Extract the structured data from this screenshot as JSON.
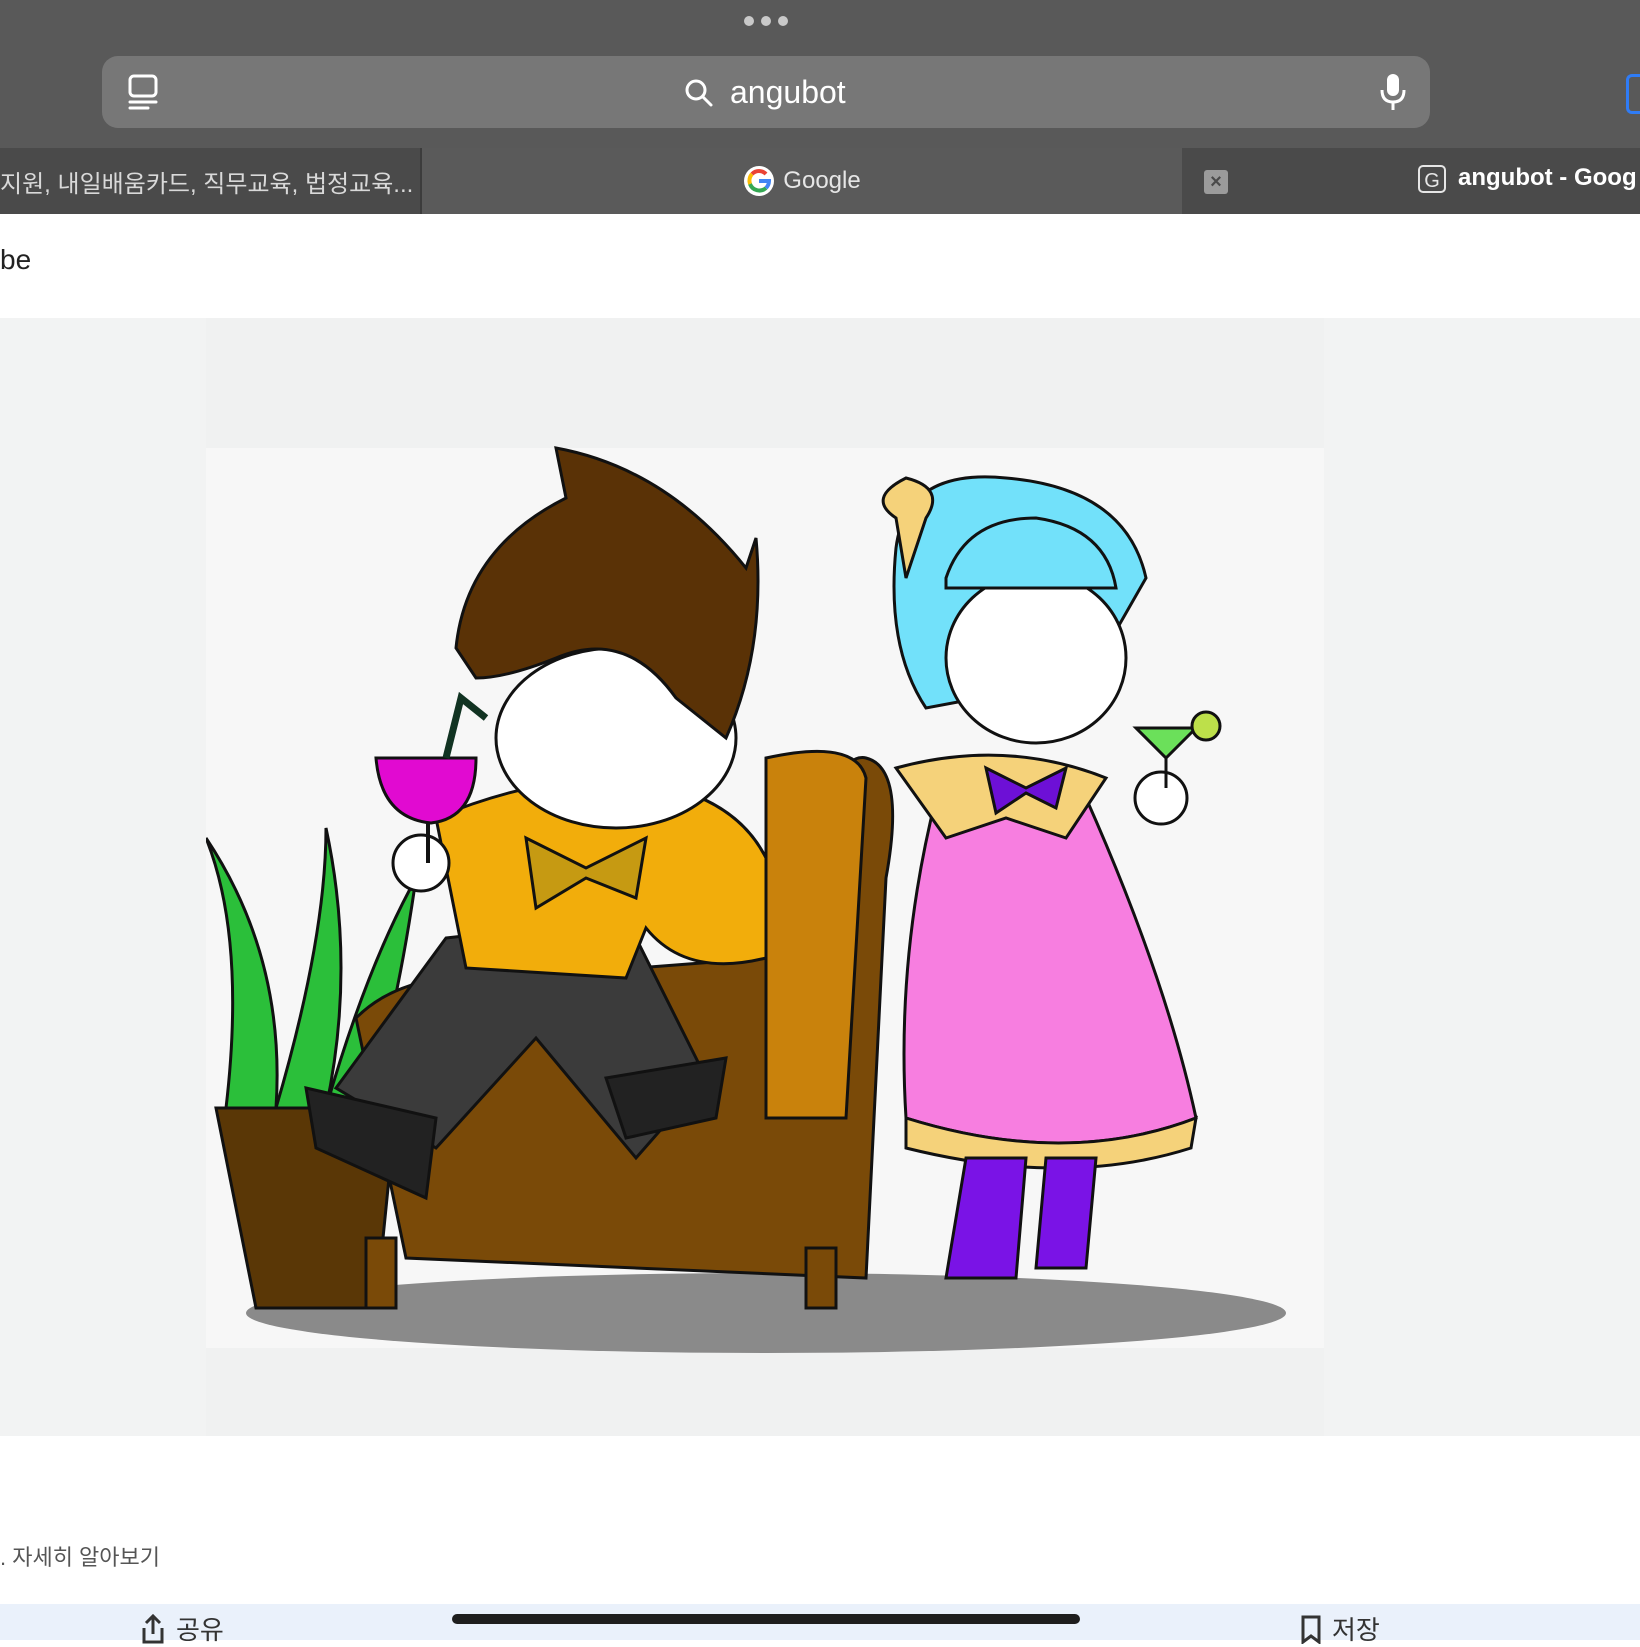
{
  "browser": {
    "search_query": "angubot",
    "tabs": [
      {
        "label": "지원, 내일배움카드, 직무교육, 법정교육..."
      },
      {
        "label": "Google"
      },
      {
        "label": "angubot - Goog"
      }
    ],
    "tab3_badge": "G",
    "close_glyph": "×"
  },
  "page": {
    "source_text": "be",
    "disclaimer": ". 자세히 알아보기",
    "share_label": "공유",
    "save_label": "저장"
  },
  "colors": {
    "toolbar": "#595959",
    "urlbar": "#777777",
    "tabbar": "#4a4a4a",
    "accent_blue": "#2f7cf6"
  },
  "icons": [
    "tabs-icon",
    "search-icon",
    "mic-icon",
    "google-logo-icon",
    "close-icon",
    "share-icon",
    "save-icon"
  ]
}
